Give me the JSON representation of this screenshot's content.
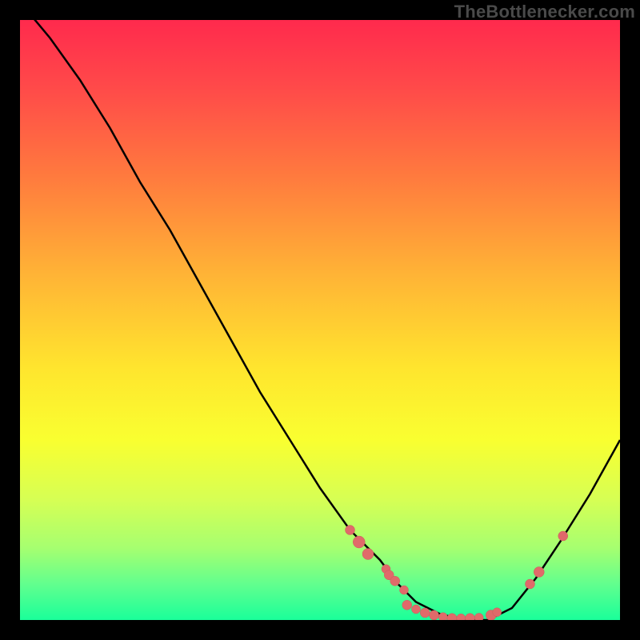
{
  "watermark": "TheBottlenecker.com",
  "colors": {
    "curve": "#000000",
    "marker_fill": "#e06a6a",
    "marker_stroke": "#c95b5b",
    "background_top": "#ff2a4d",
    "background_bottom": "#1aff9a"
  },
  "chart_data": {
    "type": "line",
    "title": "",
    "xlabel": "",
    "ylabel": "",
    "xlim": [
      0,
      100
    ],
    "ylim": [
      0,
      100
    ],
    "grid": false,
    "series": [
      {
        "name": "bottleneck-curve",
        "comment": "x is relative component score position, y is approximate bottleneck percentage; minimum (~0) at the optimal match",
        "x": [
          0,
          5,
          10,
          15,
          20,
          25,
          30,
          35,
          40,
          45,
          50,
          55,
          60,
          63,
          66,
          70,
          74,
          78,
          82,
          86,
          90,
          95,
          100
        ],
        "y": [
          103,
          97,
          90,
          82,
          73,
          65,
          56,
          47,
          38,
          30,
          22,
          15,
          10,
          6,
          3,
          1,
          0,
          0,
          2,
          7,
          13,
          21,
          30
        ]
      }
    ],
    "markers": {
      "comment": "Coral dots along the curve near the valley; one cluster on the left descent, a flat cluster at the bottom, and a cluster on the right ascent",
      "points": [
        {
          "x": 55.0,
          "y": 15.0,
          "r": 6
        },
        {
          "x": 56.5,
          "y": 13.0,
          "r": 7.5
        },
        {
          "x": 58.0,
          "y": 11.0,
          "r": 7
        },
        {
          "x": 61.0,
          "y": 8.5,
          "r": 5.5
        },
        {
          "x": 61.5,
          "y": 7.5,
          "r": 6
        },
        {
          "x": 62.5,
          "y": 6.5,
          "r": 6
        },
        {
          "x": 64.0,
          "y": 5.0,
          "r": 5.5
        },
        {
          "x": 64.5,
          "y": 2.5,
          "r": 6
        },
        {
          "x": 66.0,
          "y": 1.8,
          "r": 5.5
        },
        {
          "x": 67.5,
          "y": 1.2,
          "r": 6
        },
        {
          "x": 69.0,
          "y": 0.8,
          "r": 6
        },
        {
          "x": 70.5,
          "y": 0.5,
          "r": 5.5
        },
        {
          "x": 72.0,
          "y": 0.3,
          "r": 6
        },
        {
          "x": 73.5,
          "y": 0.3,
          "r": 5.5
        },
        {
          "x": 75.0,
          "y": 0.3,
          "r": 6
        },
        {
          "x": 76.5,
          "y": 0.4,
          "r": 5.5
        },
        {
          "x": 78.5,
          "y": 0.8,
          "r": 6.5
        },
        {
          "x": 79.5,
          "y": 1.3,
          "r": 5.5
        },
        {
          "x": 85.0,
          "y": 6.0,
          "r": 6
        },
        {
          "x": 86.5,
          "y": 8.0,
          "r": 6.5
        },
        {
          "x": 90.5,
          "y": 14.0,
          "r": 6
        }
      ]
    }
  }
}
